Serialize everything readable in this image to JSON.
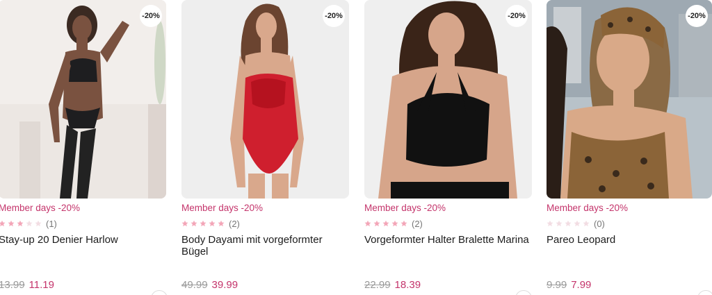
{
  "products": [
    {
      "badge": "-20%",
      "promo": "Member days -20%",
      "rating": 3,
      "reviews": "(1)",
      "name": "Stay-up 20 Denier Harlow",
      "old_price": "13.99",
      "new_price": "11.19"
    },
    {
      "badge": "-20%",
      "promo": "Member days -20%",
      "rating": 5,
      "reviews": "(2)",
      "name": "Body Dayami mit vorgeformter Bügel",
      "old_price": "49.99",
      "new_price": "39.99"
    },
    {
      "badge": "-20%",
      "promo": "Member days -20%",
      "rating": 5,
      "reviews": "(2)",
      "name": "Vorgeformter Halter Bralette Marina",
      "old_price": "22.99",
      "new_price": "18.39"
    },
    {
      "badge": "-20%",
      "promo": "Member days -20%",
      "rating": 0,
      "reviews": "(0)",
      "name": "Pareo Leopard",
      "old_price": "9.99",
      "new_price": "7.99"
    }
  ],
  "colors": {
    "promo": "#c4346b",
    "star_filled": "#f3a6b8",
    "star_empty": "#f2dde3"
  }
}
